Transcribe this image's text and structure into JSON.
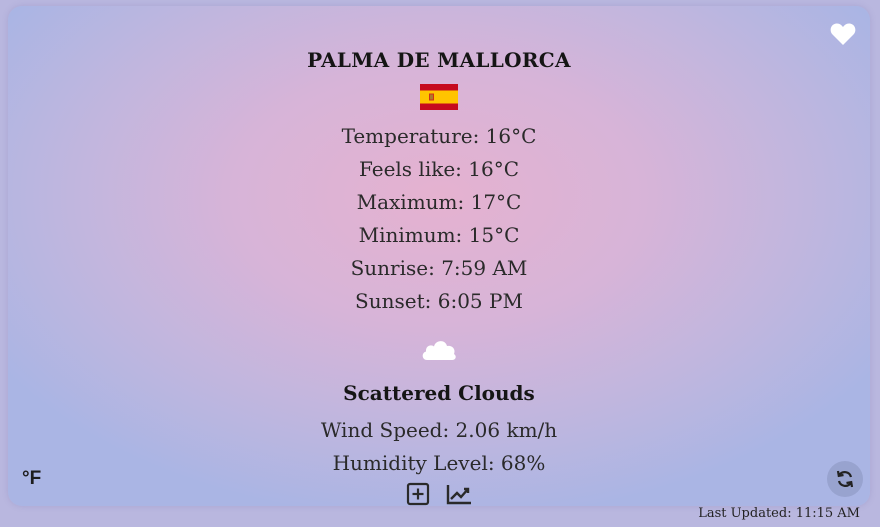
{
  "location": {
    "city": "PALMA DE MALLORCA",
    "flag_icon": "spain-flag-icon"
  },
  "conditions": {
    "temperature": "Temperature: 16°C",
    "feels_like": "Feels like: 16°C",
    "maximum": "Maximum: 17°C",
    "minimum": "Minimum: 15°C",
    "sunrise": "Sunrise: 7:59 AM",
    "sunset": "Sunset: 6:05 PM",
    "weather_icon": "cloud-icon",
    "description": "Scattered Clouds",
    "wind_speed": "Wind Speed: 2.06 km/h",
    "humidity": "Humidity Level: 68%"
  },
  "controls": {
    "unit_toggle_label": "°F",
    "favorite_icon": "heart-icon",
    "refresh_icon": "refresh-icon",
    "add_icon": "add-square-icon",
    "chart_icon": "chart-line-icon"
  },
  "footer": {
    "last_updated": "Last Updated: 11:15 AM"
  },
  "colors": {
    "card_center": "#e5b2d0",
    "card_edge": "#aab5e4",
    "text": "#2a2a2a"
  }
}
